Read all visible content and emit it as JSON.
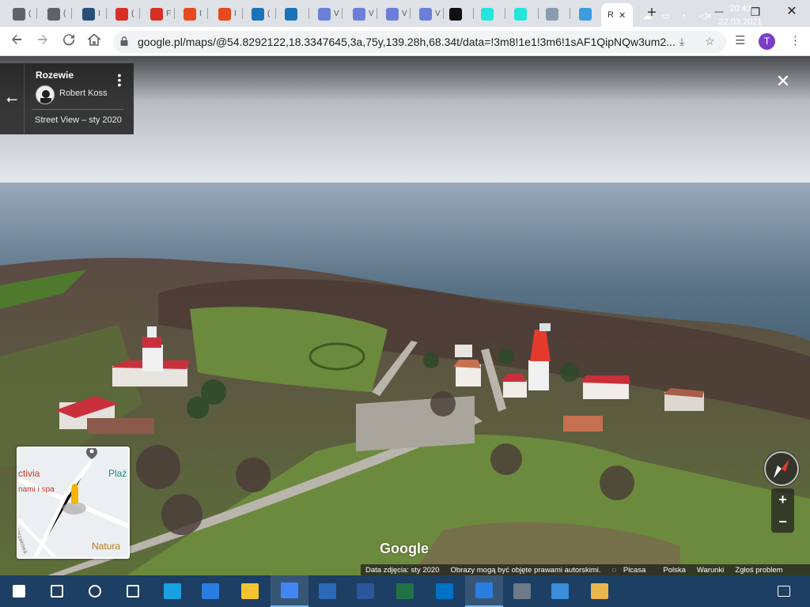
{
  "browser": {
    "tabs": [
      {
        "icon": "globe-icon",
        "label": "(",
        "color": "#5f6368"
      },
      {
        "icon": "globe-icon",
        "label": "(",
        "color": "#5f6368"
      },
      {
        "icon": "shield-icon",
        "label": "I",
        "color": "#2a4d7a"
      },
      {
        "icon": "gmail-icon",
        "label": "(",
        "color": "#d93025"
      },
      {
        "icon": "gmail-icon",
        "label": "F",
        "color": "#d93025"
      },
      {
        "icon": "mail-inbox-icon",
        "label": "I",
        "color": "#e8491d"
      },
      {
        "icon": "mail-inbox-icon",
        "label": "I",
        "color": "#e8491d"
      },
      {
        "icon": "sap-icon",
        "label": "(",
        "color": "#1a73b8"
      },
      {
        "icon": "sap-icon",
        "label": "",
        "color": "#1a73b8"
      },
      {
        "icon": "doc-icon",
        "label": "V",
        "color": "#6c7fd8"
      },
      {
        "icon": "doc-icon",
        "label": "V",
        "color": "#6c7fd8"
      },
      {
        "icon": "doc-icon",
        "label": "V",
        "color": "#6c7fd8"
      },
      {
        "icon": "doc-icon",
        "label": "V",
        "color": "#6c7fd8"
      },
      {
        "icon": "dollar-icon",
        "label": "",
        "color": "#111111"
      },
      {
        "icon": "olx-icon",
        "label": "",
        "color": "#23e5db"
      },
      {
        "icon": "olx-icon",
        "label": "",
        "color": "#23e5db"
      },
      {
        "icon": "card-icon",
        "label": "",
        "color": "#8a9bb0"
      },
      {
        "icon": "figure-icon",
        "label": "",
        "color": "#3b9de0"
      }
    ],
    "active_tab": {
      "label": "R",
      "close": "✕"
    },
    "new_tab": "+",
    "window_controls": {
      "minimize": "—",
      "restore": "❐",
      "close": "✕"
    },
    "url": "google.pl/maps/@54.8292122,18.3347645,3a,75y,139.28h,68.34t/data=!3m8!1e1!3m6!1sAF1QipNQw3um2...",
    "profile_initial": "T"
  },
  "streetview": {
    "place": "Rozewie",
    "author": "Robert Koss",
    "capture": "Street View – sty 2020",
    "close": "✕"
  },
  "minimap": {
    "labels": [
      "ctivia",
      "Plaż",
      "nami i spa",
      "Natura"
    ],
    "road": "Warzakowa"
  },
  "zoom": {
    "in": "+",
    "out": "−"
  },
  "watermark": "Google",
  "footer": {
    "date": "Data zdjęcia: sty 2020",
    "rights": "Obrazy mogą być objęte prawami autorskimi.",
    "picasa": "Picasa",
    "region": "Polska",
    "terms": "Warunki",
    "report": "Zgłoś problem"
  },
  "taskbar": {
    "time": "20:43",
    "date": "22.03.2021",
    "apps": [
      {
        "name": "windows-start-icon",
        "color": "#ffffff"
      },
      {
        "name": "search-icon",
        "color": "#ffffff"
      },
      {
        "name": "cortana-icon",
        "color": "#ffffff"
      },
      {
        "name": "task-view-icon",
        "color": "#ffffff"
      },
      {
        "name": "edge-icon",
        "color": "#1ba1e2"
      },
      {
        "name": "app-icon",
        "color": "#2a7de1"
      },
      {
        "name": "file-explorer-icon",
        "color": "#f4c430"
      },
      {
        "name": "chrome-icon",
        "color": "#4285f4"
      },
      {
        "name": "photos-icon",
        "color": "#2a6ab8"
      },
      {
        "name": "word-icon",
        "color": "#2b579a"
      },
      {
        "name": "excel-icon",
        "color": "#217346"
      },
      {
        "name": "outlook-icon",
        "color": "#0072c6"
      },
      {
        "name": "app-active-icon",
        "color": "#2a7de1"
      },
      {
        "name": "calculator-icon",
        "color": "#6c7a89"
      },
      {
        "name": "control-panel-icon",
        "color": "#3b8ed8"
      },
      {
        "name": "paint-icon",
        "color": "#e8b64c"
      }
    ]
  }
}
